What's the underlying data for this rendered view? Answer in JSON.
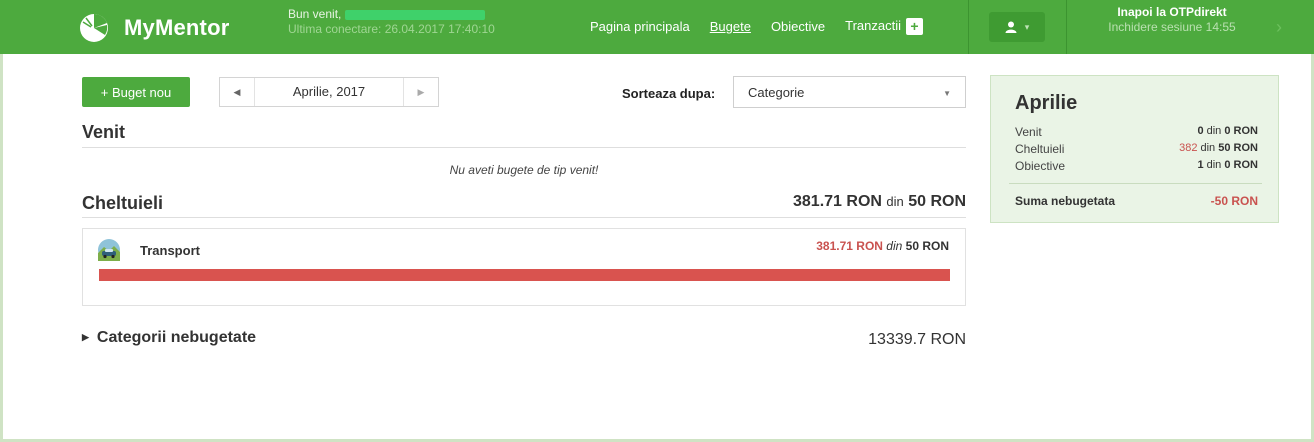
{
  "header": {
    "logo_text": "MyMentor",
    "welcome": "Bun venit,",
    "last_login": "Ultima conectare: 26.04.2017 17:40:10",
    "nav": {
      "home": "Pagina principala",
      "budgets": "Bugete",
      "goals": "Obiective",
      "transactions": "Tranzactii",
      "add": "+"
    },
    "back_title": "Inapoi la OTPdirekt",
    "session": "Inchidere sesiune 14:55"
  },
  "controls": {
    "new_budget": "+ Buget nou",
    "month": "Aprilie, 2017",
    "sort_label": "Sorteaza dupa:",
    "sort_value": "Categorie"
  },
  "income": {
    "title": "Venit",
    "empty_message": "Nu aveti bugete de tip venit!"
  },
  "expenses": {
    "title": "Cheltuieli",
    "total_spent": "381.71 RON",
    "din": "din",
    "total_budget": "50 RON",
    "items": [
      {
        "name": "Transport",
        "spent": "381.71 RON",
        "din": "din",
        "budget": "50 RON",
        "progress": 1.0
      }
    ]
  },
  "uncategorized": {
    "label": "Categorii nebugetate",
    "value": "13339.7 RON"
  },
  "summary": {
    "title": "Aprilie",
    "rows": [
      {
        "label": "Venit",
        "value": "0",
        "din": "din",
        "total": "0 RON"
      },
      {
        "label": "Cheltuieli",
        "value": "382",
        "din": "din",
        "total": "50 RON"
      },
      {
        "label": "Obiective",
        "value": "1",
        "din": "din",
        "total": "0 RON"
      }
    ],
    "total_label": "Suma nebugetata",
    "total_value": "-50 RON"
  },
  "colors": {
    "brand_green": "#4daa3e",
    "over_budget_red": "#d9534f",
    "summary_bg": "#eaf4e6"
  },
  "icons": {
    "logo": "mymentor-logo-icon",
    "user": "user-icon",
    "category_transport": "car-icon"
  }
}
